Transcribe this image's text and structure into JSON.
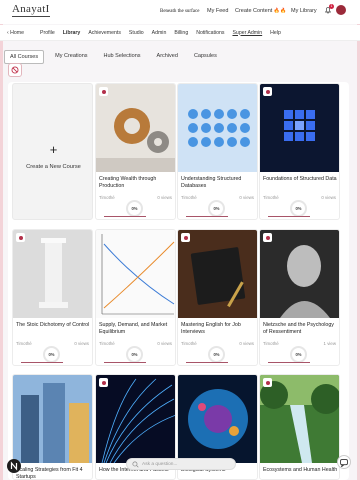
{
  "brand": {
    "logo": "AnayatI",
    "tagline": "Beneath the surface"
  },
  "topnav": {
    "my_feed": "My Feed",
    "create_content": "Create Content",
    "fire": "🔥🔥",
    "my_library": "My Library",
    "notif_count": "1"
  },
  "menu": [
    "Home",
    "Profile",
    "Library",
    "Achievements",
    "Studio",
    "Admin",
    "Billing",
    "Notifications",
    "Super Admin",
    "Help"
  ],
  "tabs": [
    "All Courses",
    "My Creations",
    "Hub Selections",
    "Archived",
    "Capsules"
  ],
  "new_course": {
    "plus": "+",
    "label": "Create a New Course"
  },
  "courses": [
    {
      "title": "Creating Wealth through Production",
      "author": "Timothé",
      "views": "0 views",
      "progress": "0%"
    },
    {
      "title": "Understanding Structured Databases",
      "author": "Timothé",
      "views": "0 views",
      "progress": "0%"
    },
    {
      "title": "Foundations of Structured Data",
      "author": "Timothé",
      "views": "0 views",
      "progress": "0%"
    },
    {
      "title": "The Stoic Dichotomy of Control",
      "author": "Timothé",
      "views": "0 views",
      "progress": "0%"
    },
    {
      "title": "Supply, Demand, and Market Equilibrium",
      "author": "Timothé",
      "views": "0 views",
      "progress": "0%"
    },
    {
      "title": "Mastering English for Job Interviews",
      "author": "Timothé",
      "views": "0 views",
      "progress": "0%"
    },
    {
      "title": "Nietzsche and the Psychology of Ressentiment",
      "author": "Timothé",
      "views": "1 view",
      "progress": "0%"
    },
    {
      "title": "Scaling Strategies from Fit 4 Startups",
      "author": "",
      "views": "",
      "progress": ""
    },
    {
      "title": "How the Internet and Packets",
      "author": "",
      "views": "",
      "progress": ""
    },
    {
      "title": "Biological Systems",
      "author": "",
      "views": "",
      "progress": ""
    },
    {
      "title": "Ecosystems and Human Health",
      "author": "",
      "views": "",
      "progress": ""
    }
  ],
  "search": {
    "placeholder": "Ask a question..."
  },
  "colors": {
    "accent": "#a85468",
    "brand_red": "#b3304a"
  }
}
